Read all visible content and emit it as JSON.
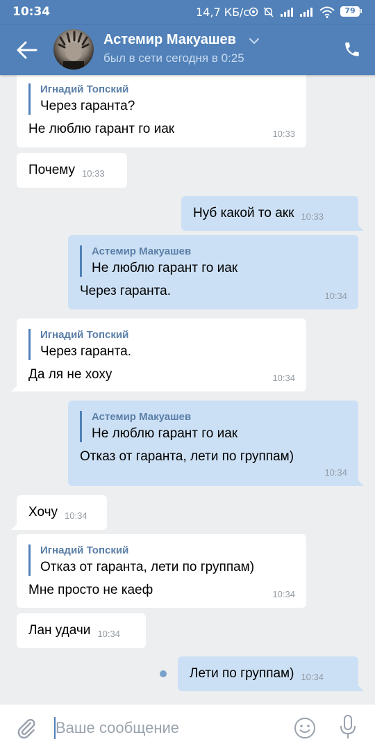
{
  "statusbar": {
    "time": "10:34",
    "net_speed": "14,7 КБ/с",
    "battery": "79"
  },
  "header": {
    "name": "Астемир Макуашев",
    "status": "был в сети сегодня в 0:25"
  },
  "messages": [
    {
      "reply_name": "Игнадий Топский",
      "reply_text": "Через гаранта?",
      "text": "Не люблю гарант го иак",
      "time": "10:33"
    },
    {
      "text": "Почему",
      "time": "10:33"
    },
    {
      "text": "Нуб какой то акк",
      "time": "10:33"
    },
    {
      "reply_name": "Астемир Макуашев",
      "reply_text": "Не люблю гарант го иак",
      "text": "Через гаранта.",
      "time": "10:34"
    },
    {
      "reply_name": "Игнадий Топский",
      "reply_text": "Через гаранта.",
      "text": "Да ля не хоху",
      "time": "10:34"
    },
    {
      "reply_name": "Астемир Макуашев",
      "reply_text": "Не люблю гарант го иак",
      "text": "Отказ от гаранта, лети по группам)",
      "time": "10:34"
    },
    {
      "text": "Хочу",
      "time": "10:34"
    },
    {
      "reply_name": "Игнадий Топский",
      "reply_text": "Отказ от гаранта, лети по группам)",
      "text": "Мне просто не каеф",
      "time": "10:34"
    },
    {
      "text": "Лан удачи",
      "time": "10:34"
    },
    {
      "text": "Лети по группам)",
      "time": "10:34"
    }
  ],
  "input": {
    "placeholder": "Ваше сообщение"
  },
  "icons": {
    "back": "arrow-left-icon",
    "dropdown": "chevron-down-icon",
    "call": "phone-icon",
    "attach": "paperclip-icon",
    "emoji": "smile-icon",
    "voice": "mic-icon"
  },
  "colors": {
    "header": "#5181b8",
    "background": "#edeef0",
    "incoming_bubble": "#ffffff",
    "outgoing_bubble": "#cce0f5",
    "accent": "#5181b8"
  }
}
